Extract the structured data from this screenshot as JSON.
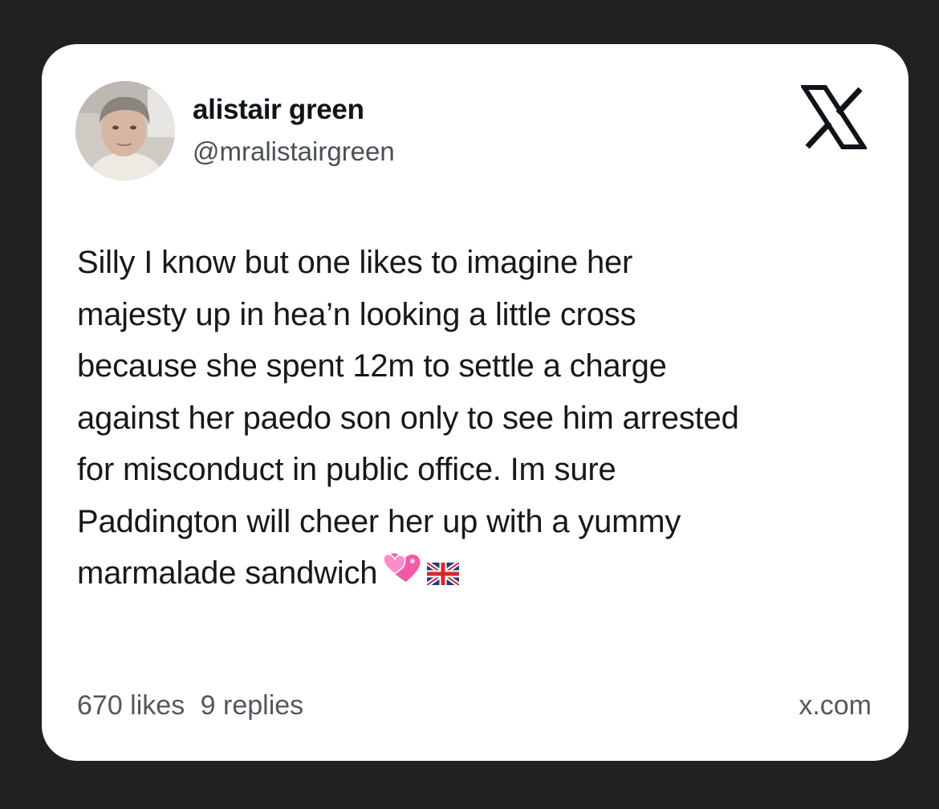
{
  "card": {
    "author": {
      "display_name": "alistair green",
      "handle": "@mralistairgreen",
      "avatar_icon": "profile-photo"
    },
    "brand_icon": "x-logo-icon",
    "text_lines": [
      "Silly I know but one likes to imagine her",
      "majesty up in hea’n looking a little cross",
      "because she spent 12m to settle a charge",
      "against her paedo son only to see him arrested",
      "for misconduct in public office. Im sure",
      "Paddington will cheer her up with a yummy",
      "marmalade sandwich"
    ],
    "emojis": [
      "two-hearts-emoji",
      "uk-flag-emoji"
    ],
    "stats": {
      "likes": "670 likes",
      "replies": "9 replies"
    },
    "domain": "x.com"
  },
  "colors": {
    "page_background": "#212121",
    "card_background": "#ffffff",
    "text_primary": "#0f1419",
    "text_secondary": "#53585e"
  }
}
